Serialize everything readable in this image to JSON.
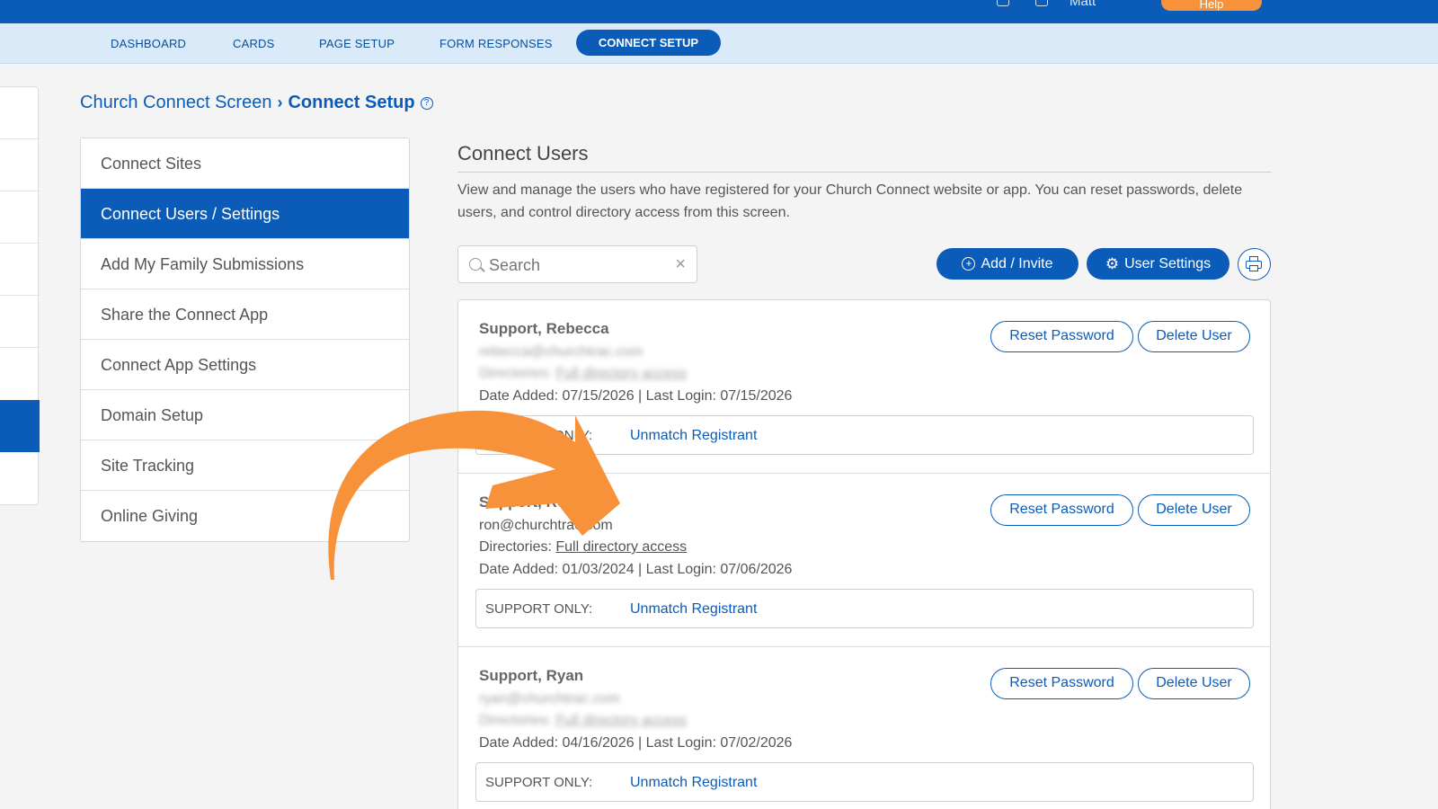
{
  "topbar": {
    "user_label": "Matt",
    "help_label": "Help",
    "brand_color": "#0b5cb8"
  },
  "nav": {
    "items": [
      "DASHBOARD",
      "CARDS",
      "PAGE SETUP",
      "FORM RESPONSES"
    ],
    "active": "CONNECT SETUP"
  },
  "breadcrumb": {
    "parent": "Church Connect Screen",
    "current": "Connect Setup",
    "help_icon": "?"
  },
  "menu": {
    "items": [
      "Connect Sites",
      "Connect Users / Settings",
      "Add My Family Submissions",
      "Share the Connect App",
      "Connect App Settings",
      "Domain Setup",
      "Site Tracking",
      "Online Giving"
    ],
    "active_index": 1
  },
  "section": {
    "title": "Connect Users",
    "description": "View and manage the users who have registered for your Church Connect website or app. You can reset passwords, delete users, and control directory access from this screen."
  },
  "search": {
    "placeholder": "Search",
    "clear_icon": "×"
  },
  "actions": {
    "add_label": "Add / Invite",
    "add_icon": "+",
    "settings_label": "User Settings",
    "settings_icon": "⚙"
  },
  "common": {
    "reset_label": "Reset Password",
    "delete_label": "Delete User",
    "support_label": "SUPPORT ONLY:",
    "unmatch_label": "Unmatch Registrant",
    "directories_label": "Directories:"
  },
  "users": [
    {
      "name": "Support, Rebecca",
      "email": "rebecca@churchtrac.com",
      "directory": "Full directory access",
      "dates": "Date Added: 07/15/2026 | Last Login: 07/15/2026"
    },
    {
      "name": "Support, Ron",
      "email": "ron@churchtrac.com",
      "directory": "Full directory access",
      "dates": "Date Added: 01/03/2024 | Last Login: 07/06/2026"
    },
    {
      "name": "Support, Ryan",
      "email": "ryan@churchtrac.com",
      "directory": "Full directory access",
      "dates": "Date Added: 04/16/2026 | Last Login: 07/02/2026"
    }
  ],
  "annotation": {
    "arrow_color": "#f7923a"
  }
}
